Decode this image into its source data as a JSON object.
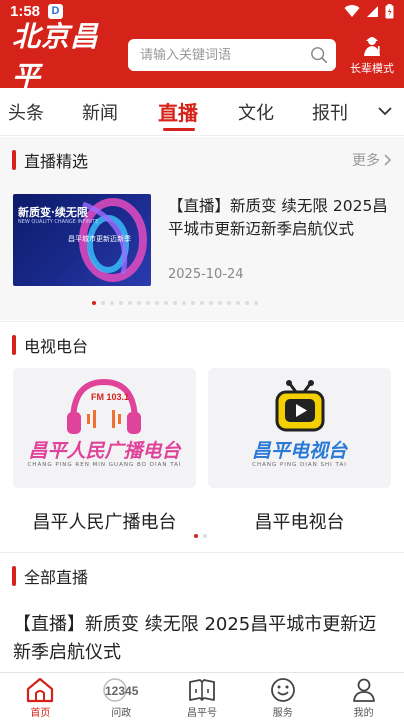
{
  "status_bar": {
    "time": "1:58",
    "app_icon_letter": "D"
  },
  "header": {
    "logo": "北京昌平",
    "search": {
      "placeholder": "请输入关键词语"
    },
    "elder_mode_label": "长辈模式"
  },
  "tabs": [
    "头条",
    "新闻",
    "直播",
    "文化",
    "报刊"
  ],
  "active_tab": "直播",
  "featured": {
    "section_title": "直播精选",
    "more_label": "更多",
    "item": {
      "thumb_title": "新质变·续无限",
      "thumb_subtitle": "NEW QUALITY CHANGE·INFINITE",
      "thumb_caption": "昌平城市更新迈新季",
      "title": "【直播】新质变 续无限 2025昌平城市更新迈新季启航仪式",
      "date": "2025-10-24"
    },
    "dots_count": 19,
    "active_dot": 0
  },
  "tv": {
    "section_title": "电视电台",
    "stations": [
      {
        "name": "昌平人民广播电台",
        "art_text": "昌平人民广播电台",
        "art_sub": "CHANG PING REN MIN GUANG BO DIAN TAI",
        "badge": "FM 103.1"
      },
      {
        "name": "昌平电视台",
        "art_text": "昌平电视台",
        "art_sub": "CHANG PING DIAN SHI TAI"
      }
    ],
    "dots_count": 2,
    "active_dot": 0
  },
  "all_live": {
    "section_title": "全部直播",
    "items": [
      {
        "title": "【直播】新质变 续无限 2025昌平城市更新迈新季启航仪式"
      }
    ]
  },
  "bottom_nav": [
    {
      "label": "首页",
      "icon": "home-icon",
      "active": true
    },
    {
      "label": "问政",
      "icon": "hotline-12345-icon",
      "icon_text": "12345",
      "active": false
    },
    {
      "label": "昌平号",
      "icon": "book-icon",
      "active": false
    },
    {
      "label": "服务",
      "icon": "smile-icon",
      "active": false
    },
    {
      "label": "我的",
      "icon": "user-icon",
      "active": false
    }
  ],
  "colors": {
    "brand_red": "#d6231a",
    "radio_pink": "#e0449a",
    "tv_blue": "#2a7ad6"
  }
}
